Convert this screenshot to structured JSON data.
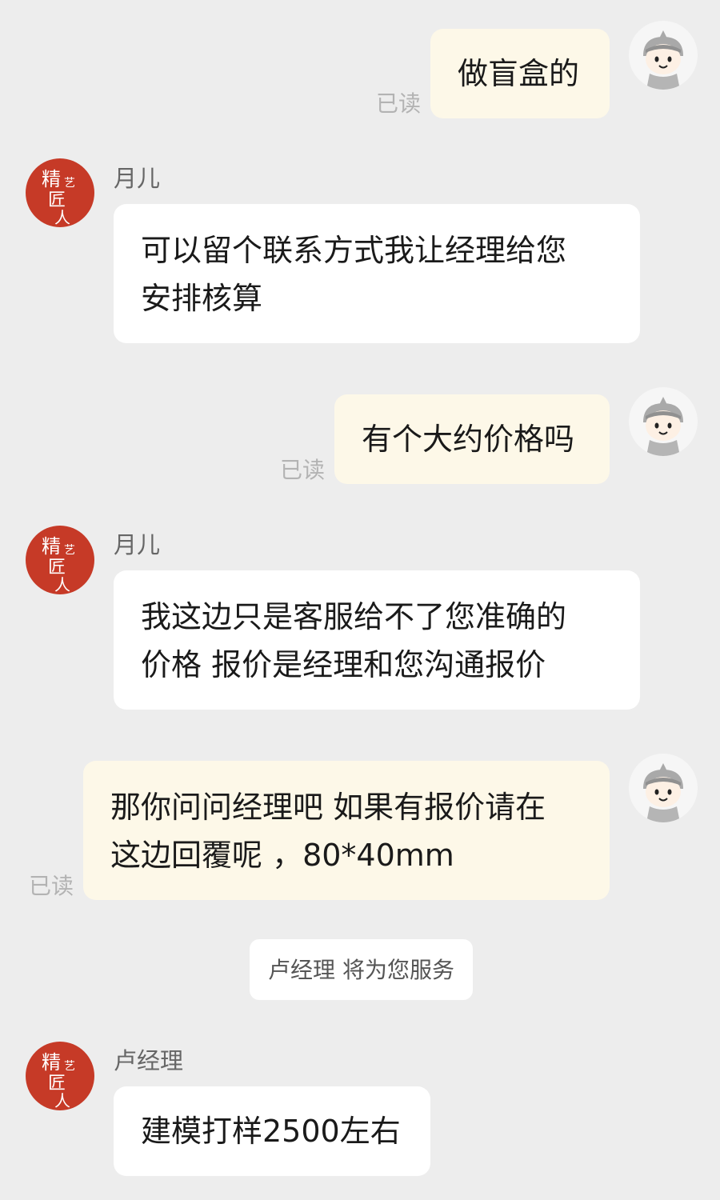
{
  "read_label": "已读",
  "brand": {
    "logo_text": "精艺匠人",
    "accent": "#c63a27"
  },
  "colors": {
    "background": "#ededed",
    "outgoing_bubble": "#fdf8e8",
    "incoming_bubble": "#ffffff"
  },
  "messages": [
    {
      "direction": "out",
      "text": "做盲盒的"
    },
    {
      "direction": "in",
      "sender": "月儿",
      "text": "可以留个联系方式我让经理给您\n安排核算"
    },
    {
      "direction": "out",
      "text": "有个大约价格吗"
    },
    {
      "direction": "in",
      "sender": "月儿",
      "text": "我这边只是客服给不了您准确的\n价格 报价是经理和您沟通报价"
    },
    {
      "direction": "out",
      "text": "那你问问经理吧 如果有报价请在\n这边回覆呢 ，80*40mm"
    },
    {
      "direction": "system",
      "text": "卢经理 将为您服务"
    },
    {
      "direction": "in",
      "sender": "卢经理",
      "text": "建模打样2500左右"
    }
  ]
}
